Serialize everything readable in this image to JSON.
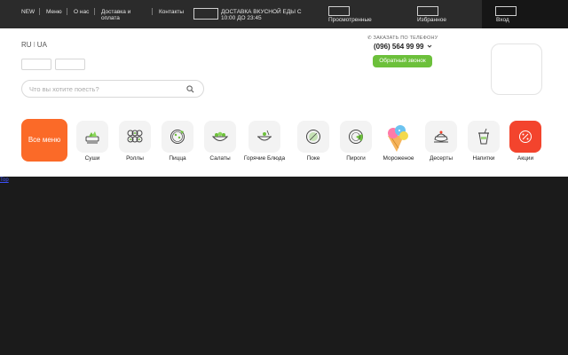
{
  "topbar": {
    "links": [
      "NEW",
      "Меню",
      "О нас",
      "Доставка и оплата",
      "Контакты"
    ],
    "delivery_text": "ДОСТАВКА ВКУСНОЙ ЕДЫ С 10:00 ДО 23:45",
    "viewed_label": "Просмотренные",
    "favorites_label": "Избранное",
    "login_label": "Вход"
  },
  "header": {
    "lang_ru": "RU",
    "lang_divider": "I",
    "lang_ua": "UA",
    "search_placeholder": "Что вы хотите поесть?",
    "phone_caption": "ЗАКАЗАТЬ ПО ТЕЛЕФОНУ",
    "phone_number": "(096) 564 99 99",
    "callback_label": "Обратный звонок"
  },
  "menu": {
    "all_label": "Все меню",
    "categories": [
      "Суши",
      "Роллы",
      "Пицца",
      "Салаты",
      "Горячие Блюда",
      "Поке",
      "Пироги",
      "Мороженое",
      "Десерты",
      "Напитки",
      "Акции"
    ]
  },
  "footer_link": "Top",
  "colors": {
    "accent_orange": "#fb6a28",
    "accent_green": "#6cc03b",
    "promo_red": "#f3442d"
  }
}
